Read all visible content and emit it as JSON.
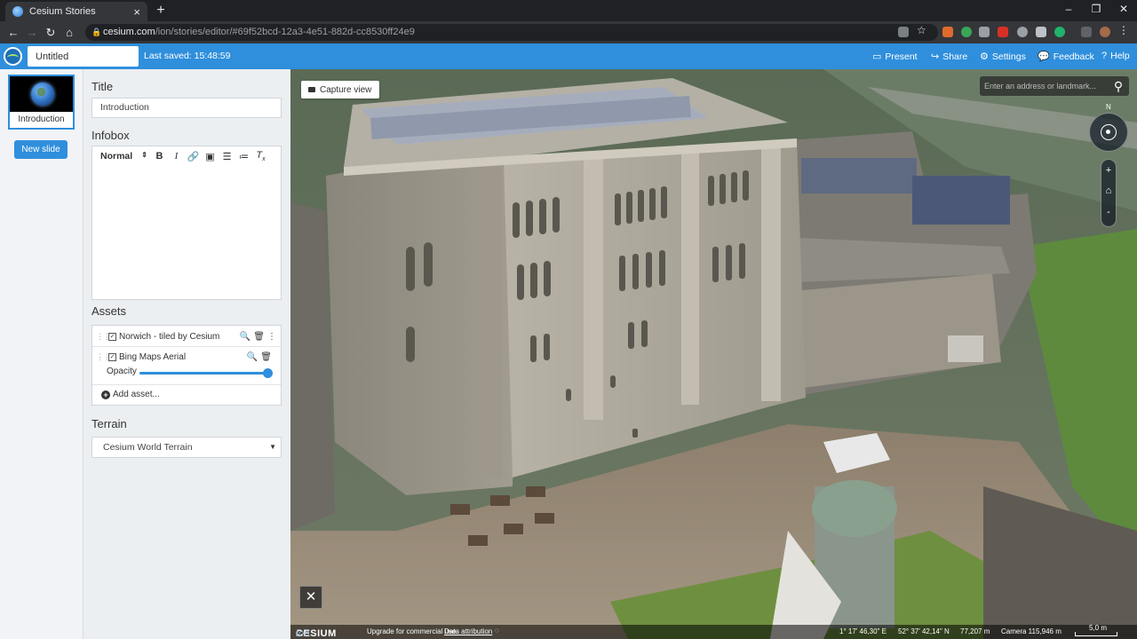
{
  "browser": {
    "tab_title": "Cesium Stories",
    "tab_close": "×",
    "new_tab": "+",
    "url_host": "cesium.com",
    "url_path": "/ion/stories/editor/#69f52bcd-12a3-4e51-882d-cc8530ff24e9",
    "window_controls": [
      "–",
      "❐",
      "✕"
    ]
  },
  "header": {
    "title_value": "Untitled",
    "last_saved": "Last saved: 15:48:59",
    "buttons": [
      {
        "icon": "monitor-icon",
        "label": "Present"
      },
      {
        "icon": "share-icon",
        "label": "Share"
      },
      {
        "icon": "gear-icon",
        "label": "Settings"
      },
      {
        "icon": "comment-icon",
        "label": "Feedback"
      },
      {
        "icon": "help-icon",
        "label": "Help"
      }
    ],
    "accent": "#2f8fdc"
  },
  "slides": {
    "items": [
      {
        "label": "Introduction"
      }
    ],
    "new_slide_label": "New slide"
  },
  "editor": {
    "title_heading": "Title",
    "title_value": "Introduction",
    "infobox_heading": "Infobox",
    "format_select": "Normal",
    "toolbar_icons": [
      "bold-icon",
      "italic-icon",
      "link-icon",
      "image-icon",
      "ordered-list-icon",
      "bullet-list-icon",
      "clear-format-icon"
    ],
    "assets_heading": "Assets",
    "assets": [
      {
        "name": "Norwich - tiled by Cesium",
        "checked": true
      },
      {
        "name": "Bing Maps Aerial",
        "checked": true
      }
    ],
    "opacity_label": "Opacity",
    "opacity_value": 1.0,
    "add_asset_label": "Add asset...",
    "terrain_heading": "Terrain",
    "terrain_value": "Cesium World Terrain"
  },
  "viewport": {
    "capture_label": "Capture view",
    "search_placeholder": "Enter an address or landmark...",
    "compass_north": "N",
    "zoom_in": "+",
    "zoom_out": "-",
    "logo_text": "CESIUM",
    "logo_suffix": "ion",
    "upgrade_text": "Upgrade for commercial use.",
    "attribution_link": "Data attribution",
    "longitude": "1° 17' 46,30\" E",
    "latitude": "52° 37' 42,14\" N",
    "height": "77,207 m",
    "camera": "Camera 115,946 m",
    "scale": "5,0 m"
  }
}
